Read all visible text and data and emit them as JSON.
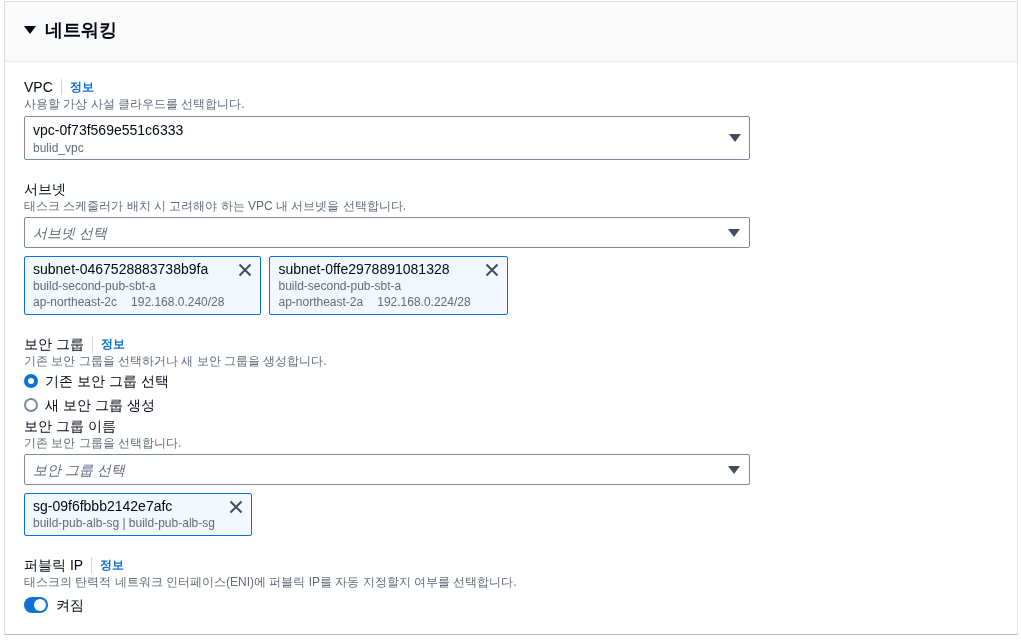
{
  "section": {
    "title": "네트워킹",
    "expanded": true,
    "fields": [
      {
        "kind": "select",
        "label": "VPC",
        "info": "정보",
        "description": "사용할 가상 사설 클라우드를 선택합니다.",
        "value": "vpc-0f73f569e551c6333",
        "value_detail": "bulid_vpc"
      },
      {
        "kind": "multiselect",
        "label": "서브넷",
        "description": "태스크 스케줄러가 배치 시 고려해야 하는 VPC 내 서브넷을 선택합니다.",
        "placeholder": "서브넷 선택",
        "tokens": [
          {
            "title": "subnet-0467528883738b9fa",
            "description": "build-second-pub-sbt-a",
            "tags": [
              "ap-northeast-2c",
              "192.168.0.240/28"
            ]
          },
          {
            "title": "subnet-0ffe2978891081328",
            "description": "build-second-pub-sbt-a",
            "tags": [
              "ap-northeast-2a",
              "192.168.0.224/28"
            ]
          }
        ]
      },
      {
        "kind": "radio_group",
        "label": "보안 그룹",
        "info": "정보",
        "description": "기존 보안 그룹을 선택하거나 새 보안 그룹을 생성합니다.",
        "options": [
          {
            "label": "기존 보안 그룹 선택",
            "selected": true
          },
          {
            "label": "새 보안 그룹 생성",
            "selected": false
          }
        ]
      },
      {
        "kind": "multiselect",
        "label": "보안 그룹 이름",
        "description": "기존 보안 그룹을 선택합니다.",
        "placeholder": "보안 그룹 선택",
        "tokens": [
          {
            "title": "sg-09f6fbbb2142e7afc",
            "description": "build-pub-alb-sg | build-pub-alb-sg"
          }
        ]
      },
      {
        "kind": "toggle",
        "label": "퍼블릭 IP",
        "info": "정보",
        "description": "태스크의 탄력적 네트워크 인터페이스(ENI)에 퍼블릭 IP를 자동 지정할지 여부를 선택합니다.",
        "on": true,
        "state_label": "켜짐"
      }
    ]
  }
}
